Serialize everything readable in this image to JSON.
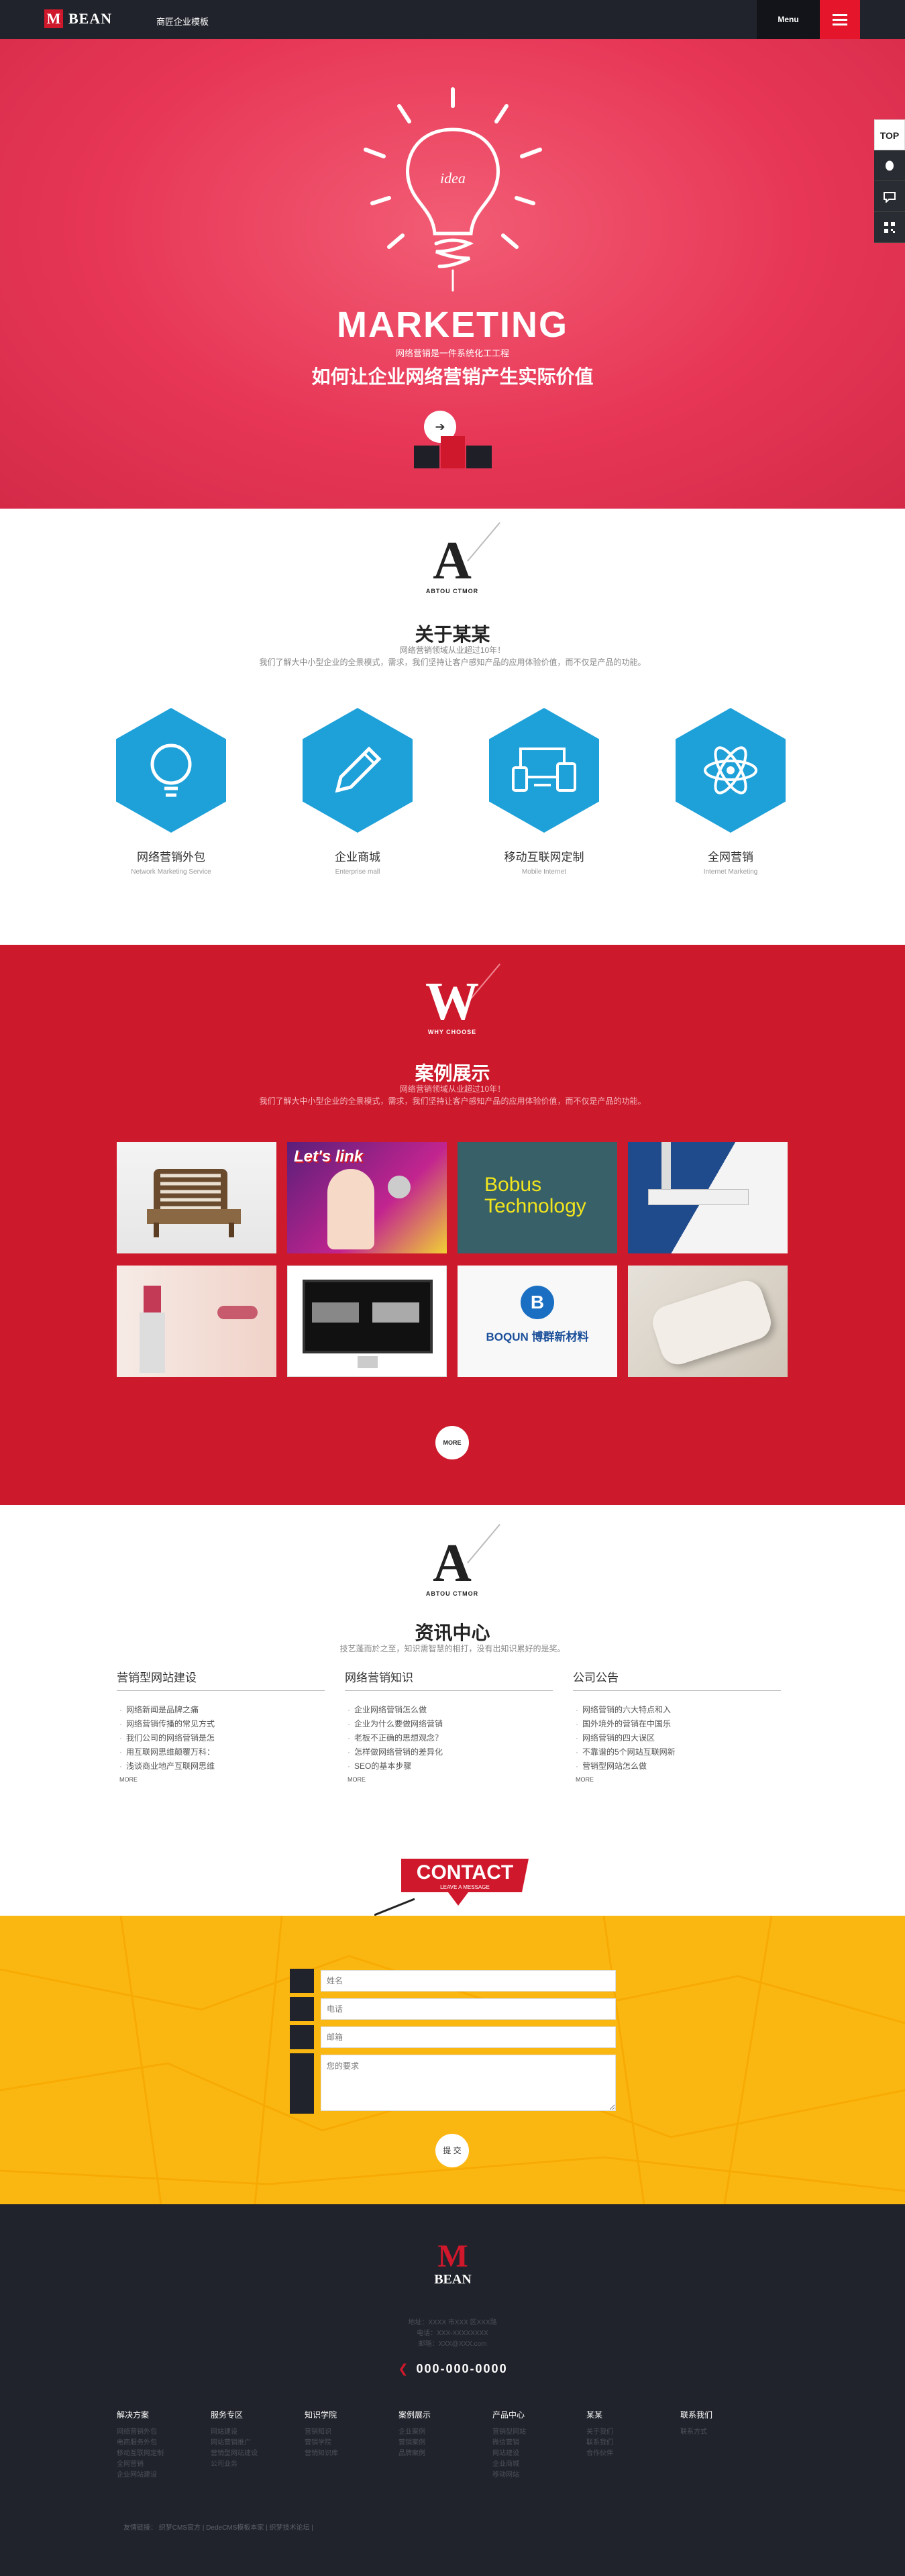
{
  "header": {
    "logo_mark": "M",
    "logo_text": "BEAN",
    "site_tagline": "商匠企业模板",
    "menu_label": "Menu"
  },
  "side_tools": [
    "TOP",
    "QQ",
    "消息",
    "二维码"
  ],
  "hero": {
    "bulb_word": "idea",
    "title": "MARKETING",
    "tagline": "网络营销是一件系统化工工程",
    "subtitle": "如何让企业网络营销产生实际价值",
    "arrow": "➔"
  },
  "about": {
    "letter": "A",
    "letter_sub": "ABTOU CTMOR",
    "title": "关于某某",
    "desc1": "网络营销领域从业超过10年！",
    "desc2": "我们了解大中小型企业的全景模式，需求，我们坚持让客户感知产品的应用体验价值，而不仅是产品的功能。",
    "services": [
      {
        "name": "网络营销外包",
        "en": "Network Marketing Service",
        "icon": "bulb-icon"
      },
      {
        "name": "企业商城",
        "en": "Enterprise mall",
        "icon": "pencil-icon"
      },
      {
        "name": "移动互联网定制",
        "en": "Mobile Internet",
        "icon": "devices-icon"
      },
      {
        "name": "全网营销",
        "en": "Internet Marketing",
        "icon": "atom-icon"
      }
    ]
  },
  "cases": {
    "letter": "W",
    "letter_sub": "WHY CHOOSE",
    "title": "案例展示",
    "desc1": "网络营销领域从业超过10年！",
    "desc2": "我们了解大中小型企业的全景模式，需求，我们坚持让客户感知产品的应用体验价值，而不仅是产品的功能。",
    "items": [
      {
        "label": "",
        "kind": "chair"
      },
      {
        "label": "Let's link",
        "kind": "music"
      },
      {
        "label": "Bobus Technology",
        "kind": "bobus"
      },
      {
        "label": "",
        "kind": "hood"
      },
      {
        "label": "",
        "kind": "lipstick"
      },
      {
        "label": "",
        "kind": "monitor"
      },
      {
        "label": "BOQUN 博群新材料",
        "kind": "boqun"
      },
      {
        "label": "",
        "kind": "device"
      }
    ],
    "more": "MORE"
  },
  "news": {
    "letter": "A",
    "letter_sub": "ABTOU CTMOR",
    "title": "资讯中心",
    "desc": "技艺蓬而於之至，知识需智慧的相打，没有出知识累好的是奖。",
    "columns": [
      {
        "head": "营销型网站建设",
        "items": [
          "网络新闻是品牌之痛",
          "网络营销传播的常见方式",
          "我们公司的网络营销是怎",
          "用互联网思维颠覆万科：",
          "浅谈商业地产互联网思维"
        ],
        "more": "MORE"
      },
      {
        "head": "网络营销知识",
        "items": [
          "企业网络营销怎么做",
          "企业为什么要做网络营销",
          "老板不正确的思想观念？",
          "怎样做网络营销的差异化",
          "SEO的基本步骤"
        ],
        "more": "MORE"
      },
      {
        "head": "公司公告",
        "items": [
          "网络营销的六大特点和入",
          "国外境外的营销在中国乐",
          "网络营销的四大误区",
          "不靠谱的5个网站互联网新",
          "营销型网站怎么做"
        ],
        "more": "MORE"
      }
    ]
  },
  "contact": {
    "badge_title": "CONTACT",
    "badge_sub": "LEAVE A MESSAGE",
    "fields": [
      {
        "value": "",
        "placeholder": "姓名"
      },
      {
        "value": "",
        "placeholder": "电话"
      },
      {
        "value": "",
        "placeholder": "邮箱"
      }
    ],
    "message_placeholder": "您的要求",
    "send": "提 交"
  },
  "footer": {
    "logo_mark": "M",
    "logo_text": "BEAN",
    "info": [
      "地址：XXXX 市XXX 区XXX路",
      "电话：XXX-XXXXXXXX",
      "邮箱：XXX@XXX.com"
    ],
    "phone": "000-000-0000",
    "columns": [
      {
        "head": "解决方案",
        "items": [
          "网络营销外包",
          "电商服务外包",
          "移动互联网定制",
          "全网营销",
          "企业网站建设"
        ]
      },
      {
        "head": "服务专区",
        "items": [
          "网站建设",
          "网站营销推广",
          "营销型网站建设",
          "公司业务"
        ]
      },
      {
        "head": "知识学院",
        "items": [
          "营销知识",
          "营销学院",
          "营销知识库"
        ]
      },
      {
        "head": "案例展示",
        "items": [
          "企业案例",
          "营销案例",
          "品牌案例"
        ]
      },
      {
        "head": "产品中心",
        "items": [
          "营销型网站",
          "微信营销",
          "网站建设",
          "企业商城",
          "移动网站"
        ]
      },
      {
        "head": "某某",
        "items": [
          "关于我们",
          "联系我们",
          "合作伙伴"
        ]
      },
      {
        "head": "联系我们",
        "items": [
          "联系方式"
        ]
      }
    ],
    "links_label": "友情链接：",
    "links": [
      "织梦CMS官方",
      "DedeCMS模板本家",
      "织梦技术论坛"
    ]
  }
}
